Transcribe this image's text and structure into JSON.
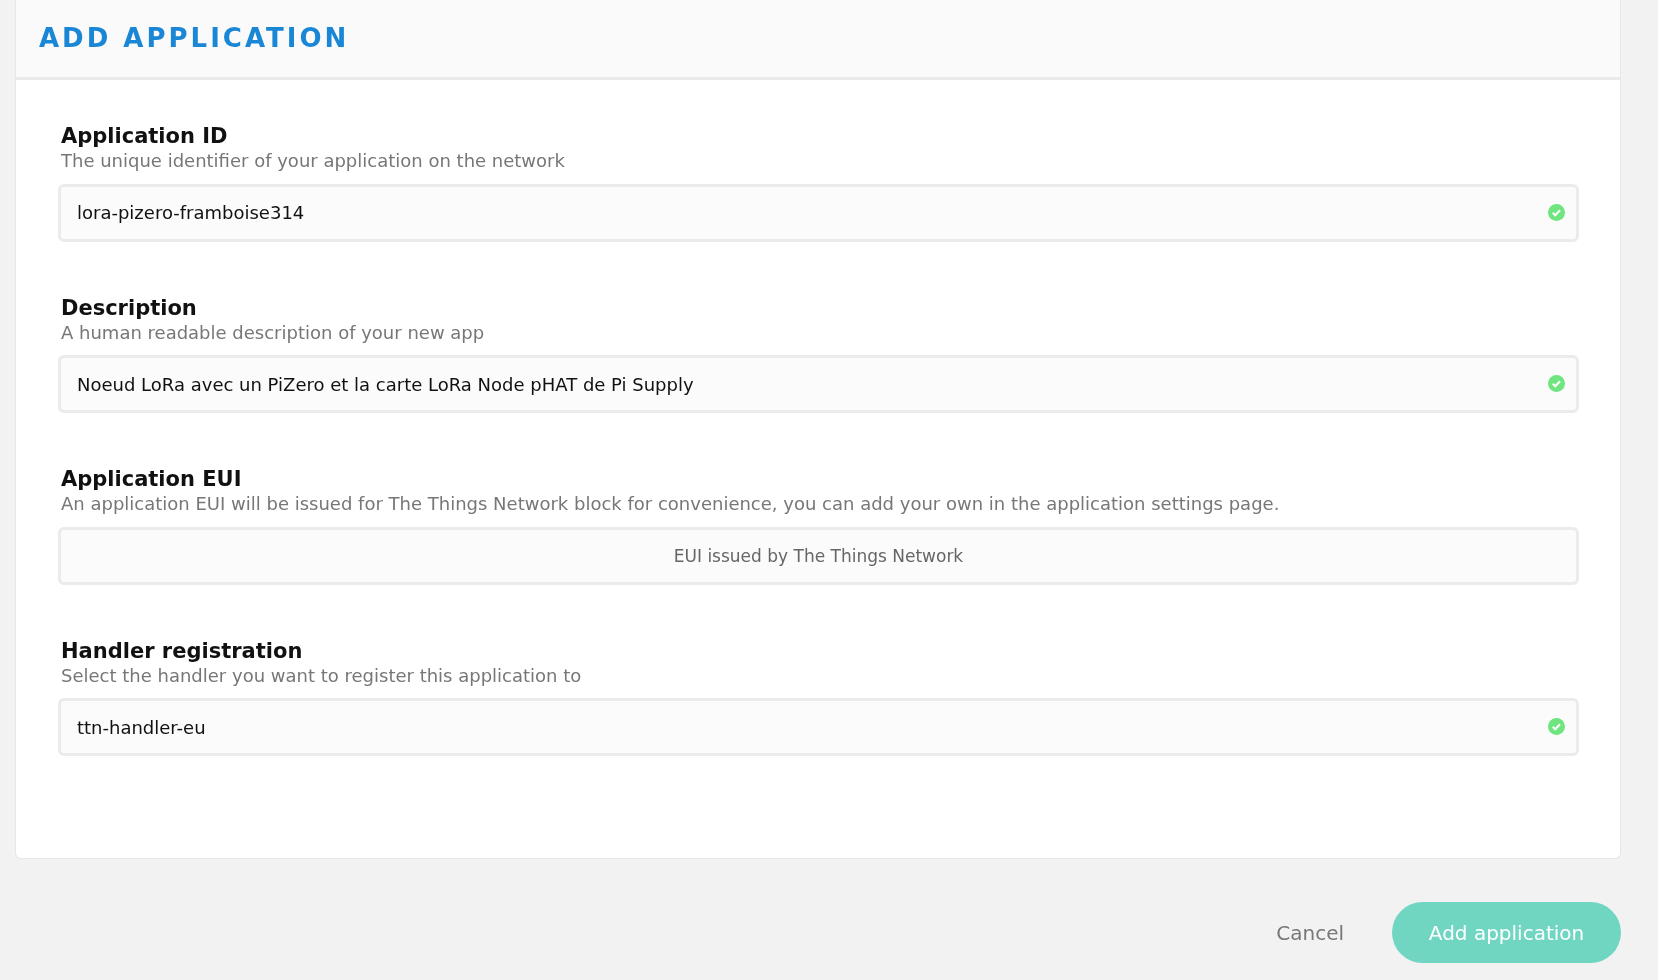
{
  "title": "ADD APPLICATION",
  "fields": [
    {
      "kind": "text",
      "label": "Application ID",
      "help": "The unique identifier of your application on the network",
      "value": "lora-pizero-framboise314",
      "valid": true
    },
    {
      "kind": "text",
      "label": "Description",
      "help": "A human readable description of your new app",
      "value": "Noeud LoRa avec un PiZero et la carte LoRa Node pHAT de Pi Supply",
      "valid": true
    },
    {
      "kind": "issued",
      "label": "Application EUI",
      "help": "An application EUI will be issued for The Things Network block for convenience, you can add your own in the application settings page.",
      "placeholder": "EUI issued by The Things Network",
      "valid": false
    },
    {
      "kind": "text",
      "label": "Handler registration",
      "help": "Select the handler you want to register this application to",
      "value": "ttn-handler-eu",
      "valid": true
    }
  ],
  "buttons": {
    "cancel": "Cancel",
    "submit": "Add application"
  }
}
